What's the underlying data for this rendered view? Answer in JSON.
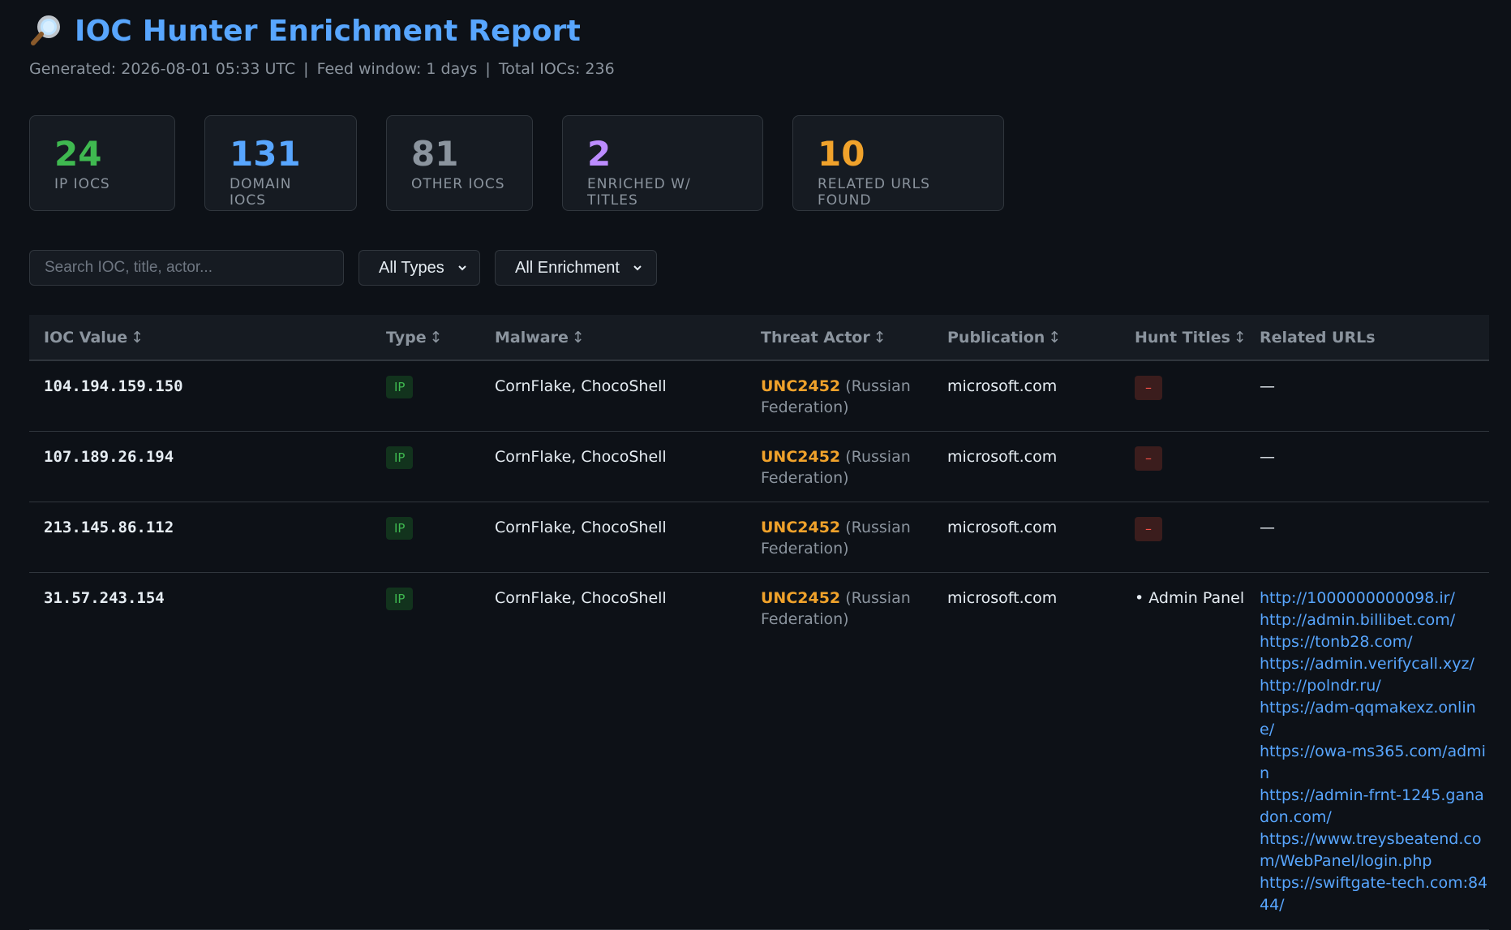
{
  "header": {
    "title": "IOC Hunter Enrichment Report",
    "title_icon": "magnifier-icon",
    "generated": "Generated: 2026-08-01 05:33 UTC",
    "feed_window": "Feed window: 1 days",
    "total": "Total IOCs: 236",
    "separator": "|"
  },
  "cards": [
    {
      "value": "24",
      "label": "IP IOCs",
      "color": "#3fb950"
    },
    {
      "value": "131",
      "label": "Domain IOCs",
      "color": "#58a6ff"
    },
    {
      "value": "81",
      "label": "Other IOCs",
      "color": "#8b949e"
    },
    {
      "value": "2",
      "label": "Enriched w/ Titles",
      "color": "#bc8cff"
    },
    {
      "value": "10",
      "label": "Related URLs Found",
      "color": "#f0a22b"
    }
  ],
  "filters": {
    "search_placeholder": "Search IOC, title, actor...",
    "type_select": "All Types",
    "enrichment_select": "All Enrichment"
  },
  "table": {
    "columns": {
      "ioc": "IOC Value",
      "type": "Type",
      "malware": "Malware",
      "actor": "Threat Actor",
      "publication": "Publication",
      "hunt": "Hunt Titles",
      "urls": "Related URLs"
    },
    "sort_glyph": "↕",
    "rows": [
      {
        "ioc": "104.194.159.150",
        "type": "IP",
        "malware": "CornFlake, ChocoShell",
        "actor": "UNC2452",
        "country": "(Russian Federation)",
        "publication": "microsoft.com",
        "hunt": "–",
        "urls_empty": "—"
      },
      {
        "ioc": "107.189.26.194",
        "type": "IP",
        "malware": "CornFlake, ChocoShell",
        "actor": "UNC2452",
        "country": "(Russian Federation)",
        "publication": "microsoft.com",
        "hunt": "–",
        "urls_empty": "—"
      },
      {
        "ioc": "213.145.86.112",
        "type": "IP",
        "malware": "CornFlake, ChocoShell",
        "actor": "UNC2452",
        "country": "(Russian Federation)",
        "publication": "microsoft.com",
        "hunt": "–",
        "urls_empty": "—"
      },
      {
        "ioc": "31.57.243.154",
        "type": "IP",
        "malware": "CornFlake, ChocoShell",
        "actor": "UNC2452",
        "country": "(Russian Federation)",
        "publication": "microsoft.com",
        "hunt_title": "• Admin Panel",
        "urls": [
          "http://1000000000098.ir/",
          "http://admin.billibet.com/",
          "https://tonb28.com/",
          "https://admin.verifycall.xyz/",
          "http://polndr.ru/",
          "https://adm-qqmakexz.online/",
          "https://owa-ms365.com/admin",
          "https://admin-frnt-1245.ganadon.com/",
          "https://www.treysbeatend.com/WebPanel/login.php",
          "https://swiftgate-tech.com:8444/"
        ]
      }
    ]
  }
}
